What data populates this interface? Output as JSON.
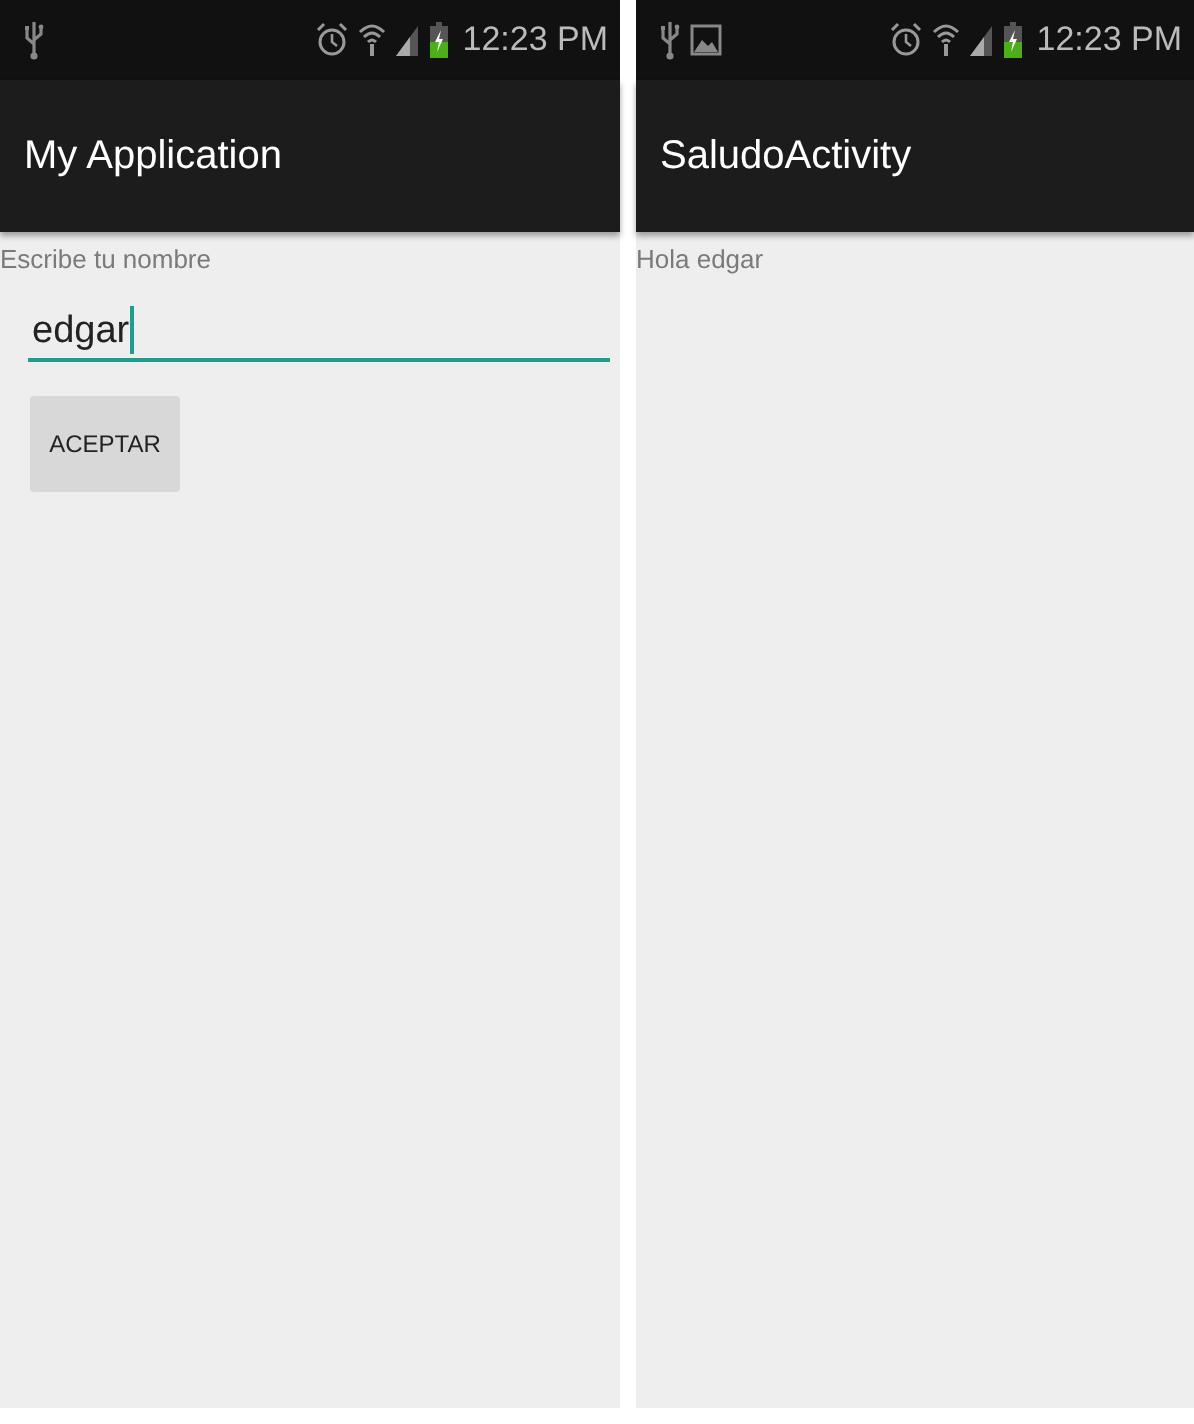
{
  "screens": [
    {
      "status_bar": {
        "notifications": [
          {
            "kind": "usb"
          }
        ],
        "time": "12:23 PM"
      },
      "app_bar": {
        "title": "My Application"
      },
      "content": [
        {
          "kind": "label",
          "text": "Escribe tu nombre"
        },
        {
          "kind": "input",
          "value": "edgar",
          "focused": true
        },
        {
          "kind": "button",
          "label": "ACEPTAR"
        }
      ]
    },
    {
      "status_bar": {
        "notifications": [
          {
            "kind": "usb"
          },
          {
            "kind": "image"
          }
        ],
        "time": "12:23 PM"
      },
      "app_bar": {
        "title": "SaludoActivity"
      },
      "content": [
        {
          "kind": "label",
          "text": "Hola edgar"
        }
      ]
    }
  ]
}
